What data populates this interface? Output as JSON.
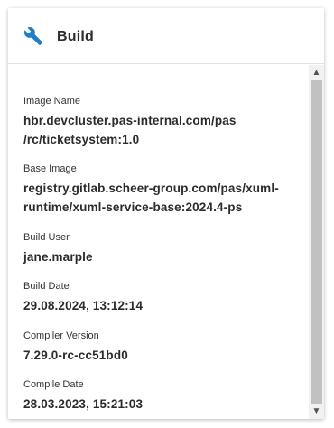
{
  "panel": {
    "title": "Build",
    "icon": "wrench-icon"
  },
  "fields": [
    {
      "label": "Image Name",
      "value": "hbr.devcluster.pas-internal.com/pas\n/rc/ticketsystem:1.0"
    },
    {
      "label": "Base Image",
      "value": "registry.gitlab.scheer-group.com/pas/xuml-\nruntime/xuml-service-base:2024.4-ps"
    },
    {
      "label": "Build User",
      "value": "jane.marple"
    },
    {
      "label": "Build Date",
      "value": "29.08.2024, 13:12:14"
    },
    {
      "label": "Compiler Version",
      "value": "7.29.0-rc-cc51bd0"
    },
    {
      "label": "Compile Date",
      "value": "28.03.2023, 15:21:03"
    }
  ],
  "colors": {
    "accent_icon": "#1e7fc7",
    "text": "#2b2b2b"
  }
}
